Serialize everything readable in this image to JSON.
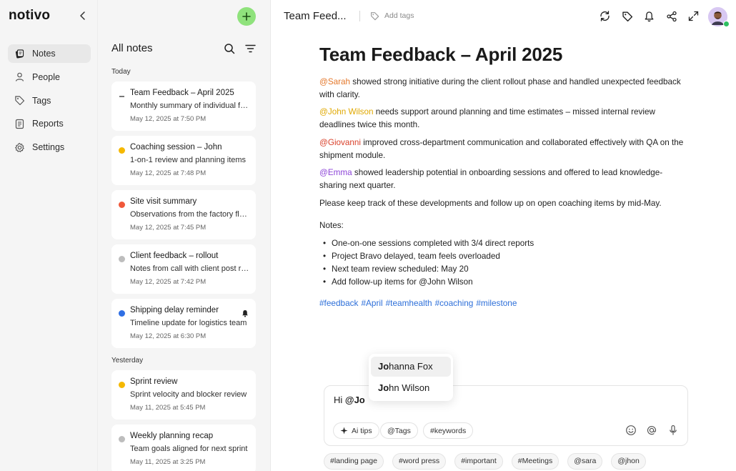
{
  "app": {
    "logo": "notivo"
  },
  "sidebar": {
    "items": [
      {
        "label": "Notes",
        "icon": "notes-icon",
        "active": true
      },
      {
        "label": "People",
        "icon": "person-icon"
      },
      {
        "label": "Tags",
        "icon": "tag-icon"
      },
      {
        "label": "Reports",
        "icon": "report-icon"
      },
      {
        "label": "Settings",
        "icon": "gear-icon"
      }
    ]
  },
  "notes_list": {
    "title": "All notes",
    "groups": [
      {
        "label": "Today"
      },
      {
        "label": "Yesterday"
      }
    ],
    "notes": [
      {
        "title": "Team Feedback – April 2025",
        "snippet": "Monthly summary of individual feedback",
        "date": "May 12, 2025 at 7:50 PM",
        "marker": "dash",
        "color": "#777777"
      },
      {
        "title": "Coaching session – John",
        "snippet": "1-on-1 review and planning items",
        "date": "May 12, 2025 at 7:48 PM",
        "marker": "dot",
        "color": "#f5b800"
      },
      {
        "title": "Site visit summary",
        "snippet": "Observations from the factory floor",
        "date": "May 12, 2025 at 7:45 PM",
        "marker": "dot",
        "color": "#f0583a"
      },
      {
        "title": "Client feedback – rollout",
        "snippet": "Notes from call with client post rollout",
        "date": "May 12, 2025 at 7:42 PM",
        "marker": "dot",
        "color": "#bdbdbd"
      },
      {
        "title": "Shipping delay reminder",
        "snippet": "Timeline update for logistics team",
        "date": "May 12, 2025 at 6:30 PM",
        "marker": "dot",
        "color": "#2f6fe4",
        "bell": true
      },
      {
        "title": "Sprint review",
        "snippet": "Sprint velocity and blocker review",
        "date": "May 11, 2025 at 5:45 PM",
        "marker": "dot",
        "color": "#f5b800"
      },
      {
        "title": "Weekly planning recap",
        "snippet": "Team goals aligned for next sprint",
        "date": "May 11, 2025 at 3:25 PM",
        "marker": "dot",
        "color": "#bdbdbd"
      }
    ]
  },
  "header": {
    "doc_title": "Team Feed...",
    "add_tags": "Add tags",
    "icons": [
      "refresh-icon",
      "tag-icon",
      "bell-icon",
      "share-icon",
      "expand-icon"
    ]
  },
  "document": {
    "title": "Team Feedback – April 2025",
    "paragraphs": [
      {
        "mention": "@Sarah",
        "text": " showed strong initiative during the client rollout phase and handled unexpected feedback with clarity."
      },
      {
        "mention": "@John Wilson",
        "text": " needs support around planning and time estimates – missed internal review deadlines twice this month."
      },
      {
        "mention": "@Giovanni",
        "text": " improved cross-department communication and collaborated effectively with QA on the shipment module."
      },
      {
        "mention": "@Emma",
        "text": " showed leadership potential in onboarding sessions and offered to lead knowledge-sharing next quarter."
      }
    ],
    "closing": "Please keep track of these developments and follow up on open coaching items by mid-May.",
    "notes_label": "Notes:",
    "bullets": [
      "One-on-one sessions completed with 3/4 direct reports",
      " Project Bravo delayed, team feels overloaded",
      "Next team review scheduled: May 20",
      "Add follow-up items for @John Wilson"
    ],
    "hashtags": [
      "#feedback",
      "#April",
      "#teamhealth",
      "#coaching",
      "#milestone"
    ]
  },
  "comment": {
    "prefix": "Hi ",
    "typed_mention": "@Jo",
    "suggestions": [
      {
        "match": "Jo",
        "rest": "hanna Fox"
      },
      {
        "match": "Jo",
        "rest": "hn Wilson"
      }
    ],
    "chips": [
      "Ai tips",
      "@Tags",
      "#keywords"
    ],
    "tool_icons": [
      "emoji-icon",
      "at-icon",
      "microphone-icon"
    ]
  },
  "suggested_tags": [
    "#landing page",
    "#word press",
    "#important",
    "#Meetings",
    "@sara",
    "@jhon"
  ]
}
